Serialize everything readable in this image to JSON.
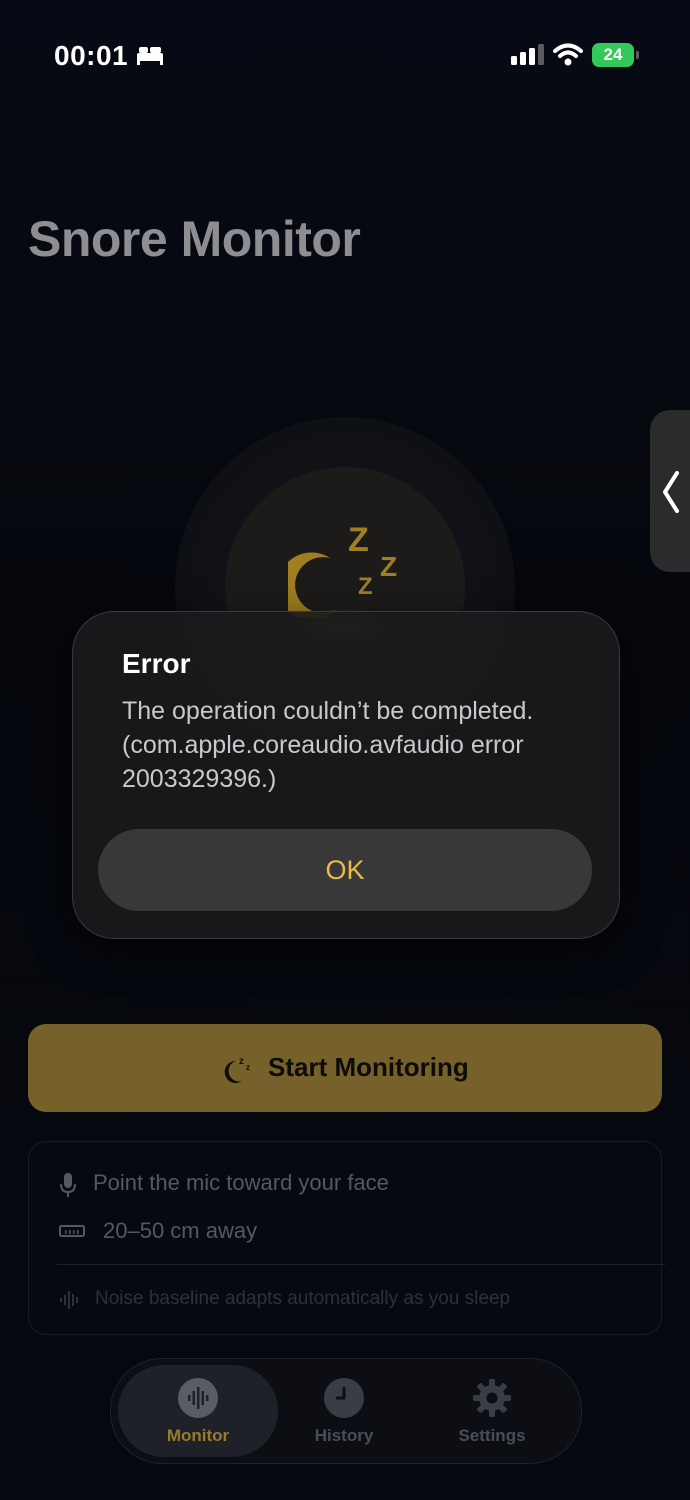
{
  "status_bar": {
    "time": "00:01",
    "battery": "24",
    "icons": [
      "bed-icon",
      "signal-icon",
      "wifi-icon",
      "battery-icon"
    ]
  },
  "header": {
    "title": "Snore Monitor"
  },
  "alert": {
    "title": "Error",
    "message": "The operation couldn’t be completed. (com.apple.coreaudio.avfaudio error 2003329396.)",
    "ok_label": "OK"
  },
  "start_button": {
    "label": "Start Monitoring",
    "icon": "moon-zzz-icon"
  },
  "tips": {
    "items": [
      {
        "icon": "microphone-icon",
        "text": "Point the mic toward your face"
      },
      {
        "icon": "ruler-icon",
        "text": "20–50 cm away"
      }
    ],
    "note": {
      "icon": "waveform-icon",
      "text": "Noise baseline adapts automatically as you sleep"
    }
  },
  "tab_bar": {
    "tabs": [
      {
        "label": "Monitor",
        "icon": "waveform-icon",
        "selected": true
      },
      {
        "label": "History",
        "icon": "clock-icon",
        "selected": false
      },
      {
        "label": "Settings",
        "icon": "gear-icon",
        "selected": false
      }
    ]
  },
  "colors": {
    "accent": "#e7bc46",
    "button_fill": "#756129",
    "background": "#05070d",
    "battery": "#34c759"
  }
}
